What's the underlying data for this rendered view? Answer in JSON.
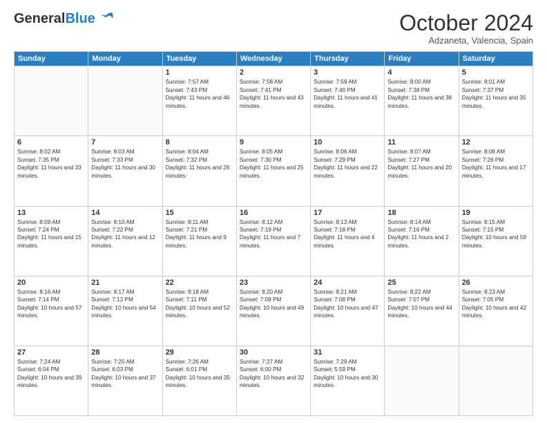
{
  "header": {
    "logo_general": "General",
    "logo_blue": "Blue",
    "month_title": "October 2024",
    "subtitle": "Adzaneta, Valencia, Spain"
  },
  "days_of_week": [
    "Sunday",
    "Monday",
    "Tuesday",
    "Wednesday",
    "Thursday",
    "Friday",
    "Saturday"
  ],
  "weeks": [
    [
      {
        "day": "",
        "empty": true
      },
      {
        "day": "",
        "empty": true
      },
      {
        "day": "1",
        "sunrise": "Sunrise: 7:57 AM",
        "sunset": "Sunset: 7:43 PM",
        "daylight": "Daylight: 11 hours and 46 minutes."
      },
      {
        "day": "2",
        "sunrise": "Sunrise: 7:58 AM",
        "sunset": "Sunset: 7:41 PM",
        "daylight": "Daylight: 11 hours and 43 minutes."
      },
      {
        "day": "3",
        "sunrise": "Sunrise: 7:59 AM",
        "sunset": "Sunset: 7:40 PM",
        "daylight": "Daylight: 11 hours and 41 minutes."
      },
      {
        "day": "4",
        "sunrise": "Sunrise: 8:00 AM",
        "sunset": "Sunset: 7:38 PM",
        "daylight": "Daylight: 11 hours and 38 minutes."
      },
      {
        "day": "5",
        "sunrise": "Sunrise: 8:01 AM",
        "sunset": "Sunset: 7:37 PM",
        "daylight": "Daylight: 11 hours and 35 minutes."
      }
    ],
    [
      {
        "day": "6",
        "sunrise": "Sunrise: 8:02 AM",
        "sunset": "Sunset: 7:35 PM",
        "daylight": "Daylight: 11 hours and 33 minutes."
      },
      {
        "day": "7",
        "sunrise": "Sunrise: 8:03 AM",
        "sunset": "Sunset: 7:33 PM",
        "daylight": "Daylight: 11 hours and 30 minutes."
      },
      {
        "day": "8",
        "sunrise": "Sunrise: 8:04 AM",
        "sunset": "Sunset: 7:32 PM",
        "daylight": "Daylight: 11 hours and 28 minutes."
      },
      {
        "day": "9",
        "sunrise": "Sunrise: 8:05 AM",
        "sunset": "Sunset: 7:30 PM",
        "daylight": "Daylight: 11 hours and 25 minutes."
      },
      {
        "day": "10",
        "sunrise": "Sunrise: 8:06 AM",
        "sunset": "Sunset: 7:29 PM",
        "daylight": "Daylight: 11 hours and 22 minutes."
      },
      {
        "day": "11",
        "sunrise": "Sunrise: 8:07 AM",
        "sunset": "Sunset: 7:27 PM",
        "daylight": "Daylight: 11 hours and 20 minutes."
      },
      {
        "day": "12",
        "sunrise": "Sunrise: 8:08 AM",
        "sunset": "Sunset: 7:26 PM",
        "daylight": "Daylight: 11 hours and 17 minutes."
      }
    ],
    [
      {
        "day": "13",
        "sunrise": "Sunrise: 8:09 AM",
        "sunset": "Sunset: 7:24 PM",
        "daylight": "Daylight: 11 hours and 15 minutes."
      },
      {
        "day": "14",
        "sunrise": "Sunrise: 8:10 AM",
        "sunset": "Sunset: 7:22 PM",
        "daylight": "Daylight: 11 hours and 12 minutes."
      },
      {
        "day": "15",
        "sunrise": "Sunrise: 8:11 AM",
        "sunset": "Sunset: 7:21 PM",
        "daylight": "Daylight: 11 hours and 9 minutes."
      },
      {
        "day": "16",
        "sunrise": "Sunrise: 8:12 AM",
        "sunset": "Sunset: 7:19 PM",
        "daylight": "Daylight: 11 hours and 7 minutes."
      },
      {
        "day": "17",
        "sunrise": "Sunrise: 8:13 AM",
        "sunset": "Sunset: 7:18 PM",
        "daylight": "Daylight: 11 hours and 4 minutes."
      },
      {
        "day": "18",
        "sunrise": "Sunrise: 8:14 AM",
        "sunset": "Sunset: 7:16 PM",
        "daylight": "Daylight: 11 hours and 2 minutes."
      },
      {
        "day": "19",
        "sunrise": "Sunrise: 8:15 AM",
        "sunset": "Sunset: 7:15 PM",
        "daylight": "Daylight: 10 hours and 59 minutes."
      }
    ],
    [
      {
        "day": "20",
        "sunrise": "Sunrise: 8:16 AM",
        "sunset": "Sunset: 7:14 PM",
        "daylight": "Daylight: 10 hours and 57 minutes."
      },
      {
        "day": "21",
        "sunrise": "Sunrise: 8:17 AM",
        "sunset": "Sunset: 7:12 PM",
        "daylight": "Daylight: 10 hours and 54 minutes."
      },
      {
        "day": "22",
        "sunrise": "Sunrise: 8:18 AM",
        "sunset": "Sunset: 7:11 PM",
        "daylight": "Daylight: 10 hours and 52 minutes."
      },
      {
        "day": "23",
        "sunrise": "Sunrise: 8:20 AM",
        "sunset": "Sunset: 7:09 PM",
        "daylight": "Daylight: 10 hours and 49 minutes."
      },
      {
        "day": "24",
        "sunrise": "Sunrise: 8:21 AM",
        "sunset": "Sunset: 7:08 PM",
        "daylight": "Daylight: 10 hours and 47 minutes."
      },
      {
        "day": "25",
        "sunrise": "Sunrise: 8:22 AM",
        "sunset": "Sunset: 7:07 PM",
        "daylight": "Daylight: 10 hours and 44 minutes."
      },
      {
        "day": "26",
        "sunrise": "Sunrise: 8:23 AM",
        "sunset": "Sunset: 7:05 PM",
        "daylight": "Daylight: 10 hours and 42 minutes."
      }
    ],
    [
      {
        "day": "27",
        "sunrise": "Sunrise: 7:24 AM",
        "sunset": "Sunset: 6:04 PM",
        "daylight": "Daylight: 10 hours and 39 minutes."
      },
      {
        "day": "28",
        "sunrise": "Sunrise: 7:25 AM",
        "sunset": "Sunset: 6:03 PM",
        "daylight": "Daylight: 10 hours and 37 minutes."
      },
      {
        "day": "29",
        "sunrise": "Sunrise: 7:26 AM",
        "sunset": "Sunset: 6:01 PM",
        "daylight": "Daylight: 10 hours and 35 minutes."
      },
      {
        "day": "30",
        "sunrise": "Sunrise: 7:27 AM",
        "sunset": "Sunset: 6:00 PM",
        "daylight": "Daylight: 10 hours and 32 minutes."
      },
      {
        "day": "31",
        "sunrise": "Sunrise: 7:29 AM",
        "sunset": "Sunset: 5:59 PM",
        "daylight": "Daylight: 10 hours and 30 minutes."
      },
      {
        "day": "",
        "empty": true
      },
      {
        "day": "",
        "empty": true
      }
    ]
  ]
}
